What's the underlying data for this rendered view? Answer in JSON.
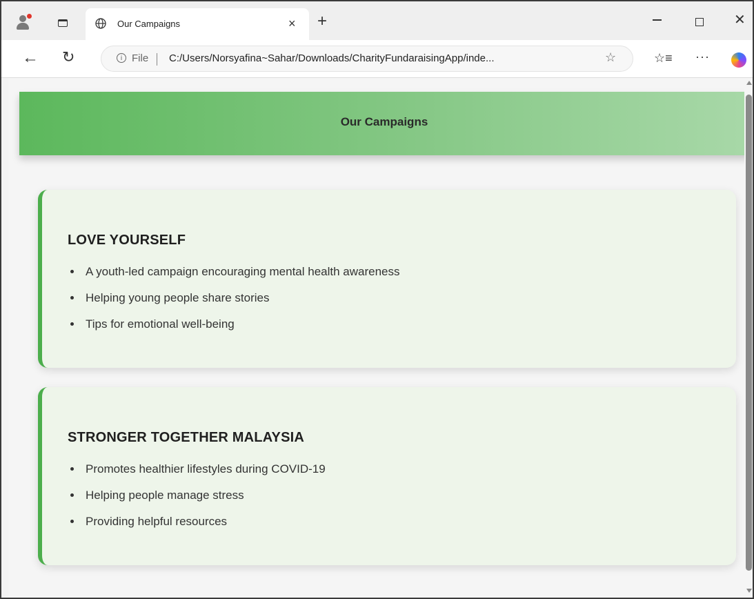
{
  "browser": {
    "tab_title": "Our Campaigns",
    "tab_close": "×",
    "new_tab": "+",
    "file_label": "File",
    "url": "C:/Users/Norsyafina~Sahar/Downloads/CharityFundaraisingApp/inde...",
    "icons": [
      "profile-icon",
      "tab-actions-icon",
      "globe-icon",
      "back-arrow-icon",
      "refresh-icon",
      "info-icon",
      "favorite-star-icon",
      "favorites-list-icon",
      "more-icon",
      "copilot-icon"
    ]
  },
  "page": {
    "header_title": "Our Campaigns",
    "colors": {
      "header_start": "#5cb85c",
      "header_end": "#a8d8a8",
      "card_bg": "#eef5ea",
      "card_accent": "#4cae4c"
    },
    "campaigns": [
      {
        "title": "LOVE YOURSELF",
        "points": [
          "A youth-led campaign encouraging mental health awareness",
          "Helping young people share stories",
          "Tips for emotional well-being"
        ]
      },
      {
        "title": "STRONGER TOGETHER MALAYSIA",
        "points": [
          "Promotes healthier lifestyles during COVID-19",
          "Helping people manage stress",
          "Providing helpful resources"
        ]
      }
    ]
  }
}
